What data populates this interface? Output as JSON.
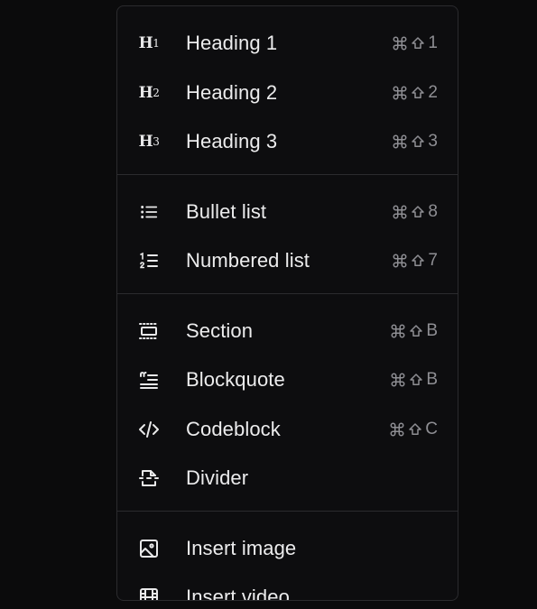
{
  "menu": {
    "groups": [
      {
        "items": [
          {
            "label": "Heading 1",
            "icon": "heading-1-icon",
            "icon_text": "H",
            "icon_sub": "1",
            "shortcut_key": "1"
          },
          {
            "label": "Heading 2",
            "icon": "heading-2-icon",
            "icon_text": "H",
            "icon_sub": "2",
            "shortcut_key": "2"
          },
          {
            "label": "Heading 3",
            "icon": "heading-3-icon",
            "icon_text": "H",
            "icon_sub": "3",
            "shortcut_key": "3"
          }
        ]
      },
      {
        "items": [
          {
            "label": "Bullet list",
            "icon": "bullet-list-icon",
            "shortcut_key": "8"
          },
          {
            "label": "Numbered list",
            "icon": "numbered-list-icon",
            "shortcut_key": "7"
          }
        ]
      },
      {
        "items": [
          {
            "label": "Section",
            "icon": "section-icon",
            "shortcut_key": "B"
          },
          {
            "label": "Blockquote",
            "icon": "blockquote-icon",
            "shortcut_key": "B"
          },
          {
            "label": "Codeblock",
            "icon": "codeblock-icon",
            "shortcut_key": "C"
          },
          {
            "label": "Divider",
            "icon": "divider-icon",
            "shortcut_key": ""
          }
        ]
      },
      {
        "items": [
          {
            "label": "Insert image",
            "icon": "image-icon",
            "shortcut_key": ""
          },
          {
            "label": "Insert video",
            "icon": "video-icon",
            "shortcut_key": ""
          }
        ]
      }
    ],
    "shortcut_modifiers": [
      "command-icon",
      "shift-icon"
    ]
  },
  "colors": {
    "background": "#0b0b0c",
    "menu_background": "#0d0d0f",
    "border": "#2b2b2e",
    "label": "#ececed",
    "shortcut": "#8e8e93"
  }
}
